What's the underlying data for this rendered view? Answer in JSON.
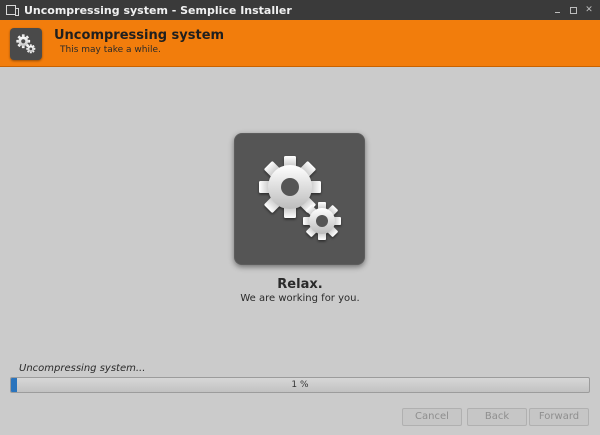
{
  "window": {
    "title": "Uncompressing system - Semplice Installer",
    "app_icon": "window-app-icon",
    "controls": [
      "minimize-icon",
      "maximize-icon",
      "close-icon"
    ]
  },
  "header": {
    "title": "Uncompressing system",
    "subtitle": "This may take a while.",
    "icon": "gears-icon",
    "accent_color": "#f27d0c"
  },
  "main": {
    "illustration_icon": "gears-icon",
    "heading": "Relax.",
    "message": "We are working for you."
  },
  "progress": {
    "status_text": "Uncompressing system...",
    "percent_text": "1 %",
    "value": 0.01,
    "fill_color": "#2a74bd"
  },
  "buttons": {
    "cancel": "Cancel",
    "back": "Back",
    "forward": "Forward"
  }
}
